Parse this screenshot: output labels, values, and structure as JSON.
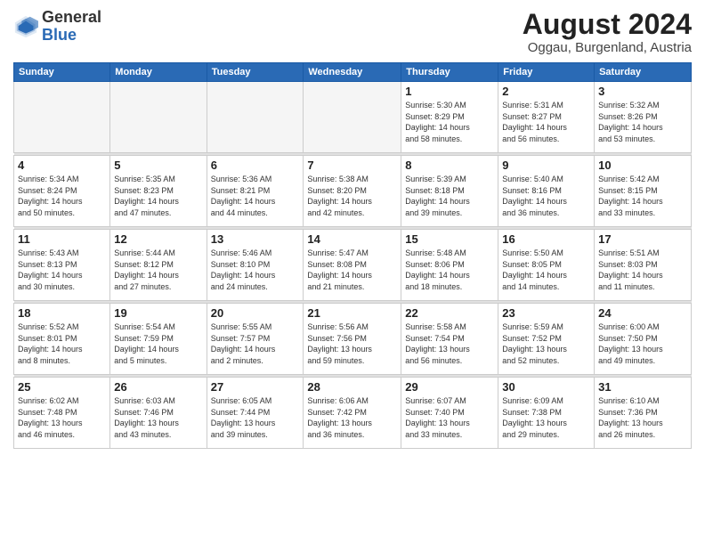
{
  "header": {
    "logo_general": "General",
    "logo_blue": "Blue",
    "title": "August 2024",
    "subtitle": "Oggau, Burgenland, Austria"
  },
  "weekdays": [
    "Sunday",
    "Monday",
    "Tuesday",
    "Wednesday",
    "Thursday",
    "Friday",
    "Saturday"
  ],
  "weeks": [
    {
      "days": [
        {
          "num": "",
          "info": ""
        },
        {
          "num": "",
          "info": ""
        },
        {
          "num": "",
          "info": ""
        },
        {
          "num": "",
          "info": ""
        },
        {
          "num": "1",
          "info": "Sunrise: 5:30 AM\nSunset: 8:29 PM\nDaylight: 14 hours\nand 58 minutes."
        },
        {
          "num": "2",
          "info": "Sunrise: 5:31 AM\nSunset: 8:27 PM\nDaylight: 14 hours\nand 56 minutes."
        },
        {
          "num": "3",
          "info": "Sunrise: 5:32 AM\nSunset: 8:26 PM\nDaylight: 14 hours\nand 53 minutes."
        }
      ]
    },
    {
      "days": [
        {
          "num": "4",
          "info": "Sunrise: 5:34 AM\nSunset: 8:24 PM\nDaylight: 14 hours\nand 50 minutes."
        },
        {
          "num": "5",
          "info": "Sunrise: 5:35 AM\nSunset: 8:23 PM\nDaylight: 14 hours\nand 47 minutes."
        },
        {
          "num": "6",
          "info": "Sunrise: 5:36 AM\nSunset: 8:21 PM\nDaylight: 14 hours\nand 44 minutes."
        },
        {
          "num": "7",
          "info": "Sunrise: 5:38 AM\nSunset: 8:20 PM\nDaylight: 14 hours\nand 42 minutes."
        },
        {
          "num": "8",
          "info": "Sunrise: 5:39 AM\nSunset: 8:18 PM\nDaylight: 14 hours\nand 39 minutes."
        },
        {
          "num": "9",
          "info": "Sunrise: 5:40 AM\nSunset: 8:16 PM\nDaylight: 14 hours\nand 36 minutes."
        },
        {
          "num": "10",
          "info": "Sunrise: 5:42 AM\nSunset: 8:15 PM\nDaylight: 14 hours\nand 33 minutes."
        }
      ]
    },
    {
      "days": [
        {
          "num": "11",
          "info": "Sunrise: 5:43 AM\nSunset: 8:13 PM\nDaylight: 14 hours\nand 30 minutes."
        },
        {
          "num": "12",
          "info": "Sunrise: 5:44 AM\nSunset: 8:12 PM\nDaylight: 14 hours\nand 27 minutes."
        },
        {
          "num": "13",
          "info": "Sunrise: 5:46 AM\nSunset: 8:10 PM\nDaylight: 14 hours\nand 24 minutes."
        },
        {
          "num": "14",
          "info": "Sunrise: 5:47 AM\nSunset: 8:08 PM\nDaylight: 14 hours\nand 21 minutes."
        },
        {
          "num": "15",
          "info": "Sunrise: 5:48 AM\nSunset: 8:06 PM\nDaylight: 14 hours\nand 18 minutes."
        },
        {
          "num": "16",
          "info": "Sunrise: 5:50 AM\nSunset: 8:05 PM\nDaylight: 14 hours\nand 14 minutes."
        },
        {
          "num": "17",
          "info": "Sunrise: 5:51 AM\nSunset: 8:03 PM\nDaylight: 14 hours\nand 11 minutes."
        }
      ]
    },
    {
      "days": [
        {
          "num": "18",
          "info": "Sunrise: 5:52 AM\nSunset: 8:01 PM\nDaylight: 14 hours\nand 8 minutes."
        },
        {
          "num": "19",
          "info": "Sunrise: 5:54 AM\nSunset: 7:59 PM\nDaylight: 14 hours\nand 5 minutes."
        },
        {
          "num": "20",
          "info": "Sunrise: 5:55 AM\nSunset: 7:57 PM\nDaylight: 14 hours\nand 2 minutes."
        },
        {
          "num": "21",
          "info": "Sunrise: 5:56 AM\nSunset: 7:56 PM\nDaylight: 13 hours\nand 59 minutes."
        },
        {
          "num": "22",
          "info": "Sunrise: 5:58 AM\nSunset: 7:54 PM\nDaylight: 13 hours\nand 56 minutes."
        },
        {
          "num": "23",
          "info": "Sunrise: 5:59 AM\nSunset: 7:52 PM\nDaylight: 13 hours\nand 52 minutes."
        },
        {
          "num": "24",
          "info": "Sunrise: 6:00 AM\nSunset: 7:50 PM\nDaylight: 13 hours\nand 49 minutes."
        }
      ]
    },
    {
      "days": [
        {
          "num": "25",
          "info": "Sunrise: 6:02 AM\nSunset: 7:48 PM\nDaylight: 13 hours\nand 46 minutes."
        },
        {
          "num": "26",
          "info": "Sunrise: 6:03 AM\nSunset: 7:46 PM\nDaylight: 13 hours\nand 43 minutes."
        },
        {
          "num": "27",
          "info": "Sunrise: 6:05 AM\nSunset: 7:44 PM\nDaylight: 13 hours\nand 39 minutes."
        },
        {
          "num": "28",
          "info": "Sunrise: 6:06 AM\nSunset: 7:42 PM\nDaylight: 13 hours\nand 36 minutes."
        },
        {
          "num": "29",
          "info": "Sunrise: 6:07 AM\nSunset: 7:40 PM\nDaylight: 13 hours\nand 33 minutes."
        },
        {
          "num": "30",
          "info": "Sunrise: 6:09 AM\nSunset: 7:38 PM\nDaylight: 13 hours\nand 29 minutes."
        },
        {
          "num": "31",
          "info": "Sunrise: 6:10 AM\nSunset: 7:36 PM\nDaylight: 13 hours\nand 26 minutes."
        }
      ]
    }
  ]
}
